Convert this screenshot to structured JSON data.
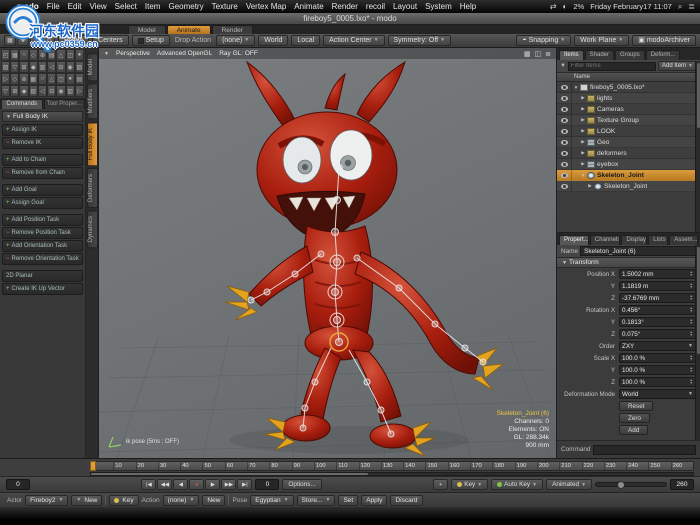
{
  "watermark": {
    "title": "河东软件园",
    "url": "www.pc0359.cn"
  },
  "menubar": {
    "apple": "",
    "items": [
      "modo",
      "File",
      "Edit",
      "View",
      "Select",
      "Item",
      "Geometry",
      "Texture",
      "Vertex Map",
      "Animate",
      "Render",
      "recoil",
      "Layout",
      "System",
      "Help"
    ],
    "status_icons": [
      "⇄",
      "◐"
    ],
    "battery": "2%",
    "clock": "Friday February17 11:07",
    "search_icon": "⌕",
    "list_icon": "≣"
  },
  "titlebar": {
    "title": "fireboy5_0005.lxo* - modo"
  },
  "layout_tabs": {
    "tabs": [
      {
        "label": "Model"
      },
      {
        "label": "Animate",
        "active": true
      },
      {
        "label": "Render"
      }
    ]
  },
  "toolbar": {
    "left_icons": [
      "▦",
      "✚",
      "○",
      "◇"
    ],
    "pivots": "Pivots",
    "centers": "Centers",
    "setup": "Setup",
    "drop_action_label": "Drop Action",
    "drop_action_value": "(none)",
    "world": "World",
    "local": "Local",
    "action_center": "Action Center",
    "symmetry": "Symmetry: Off",
    "snapping": "Snapping",
    "snapping_icon": "◓",
    "work_plane": "Work Plane",
    "archiver": "modoArchiver",
    "archiver_icon": "▣"
  },
  "palette": {
    "glyphs": [
      "◰",
      "▦",
      "○",
      "◇",
      "⊕",
      "▤",
      "△",
      "◫",
      "●",
      "▧",
      "▽",
      "⊞",
      "◆",
      "▥",
      "◁",
      "⊟",
      "◉",
      "▨",
      "▷",
      "◇",
      "⊕",
      "▦",
      "○",
      "△",
      "◫",
      "●",
      "▤",
      "▽",
      "⊞",
      "◆",
      "▧",
      "◁",
      "⊟",
      "◉",
      "▥",
      "▷"
    ]
  },
  "left_panel": {
    "tabs": [
      {
        "label": "Commands",
        "active": true
      },
      {
        "label": "Tool Proper..."
      }
    ],
    "section": "Full Body IK",
    "buttons": [
      {
        "label": "Assign IK",
        "icon": "+"
      },
      {
        "label": "Remove IK",
        "icon": "−",
        "gap": true
      },
      {
        "label": "Add to Chain",
        "icon": "+"
      },
      {
        "label": "Remove from Chain",
        "icon": "−",
        "gap": true
      },
      {
        "label": "Add Goal",
        "icon": "+"
      },
      {
        "label": "Assign Goal",
        "icon": "+",
        "gap": true
      },
      {
        "label": "Add Position Task",
        "icon": "+"
      },
      {
        "label": "Remove Position Task",
        "icon": "−"
      },
      {
        "label": "Add Orientation Task",
        "icon": "+"
      },
      {
        "label": "Remove Orientation Task",
        "icon": "−",
        "gap": true
      },
      {
        "label": "2D Planar",
        "icon": ""
      },
      {
        "label": "Create IK Up Vector",
        "icon": "+"
      }
    ],
    "vertical_tabs": [
      {
        "label": "Model"
      },
      {
        "label": "Modifiers"
      },
      {
        "label": "Full Body IK",
        "active": true
      },
      {
        "label": "Deformers"
      },
      {
        "label": "Dynamics"
      }
    ]
  },
  "viewport": {
    "view_mode": "Perspective",
    "shading": "Advanced OpenGL",
    "raygl": "Ray GL: OFF",
    "header_icons": [
      "▦",
      "◫",
      "≣"
    ],
    "axis_label": "ik pose (5ms : OFF)",
    "info_title": "Skeleton_Joint (6)",
    "info_lines": [
      "Channels: 0",
      "Elements: ON",
      "GL: 288.34k",
      "900 mm"
    ]
  },
  "items_panel": {
    "tabs": [
      {
        "label": "Items",
        "active": true
      },
      {
        "label": "Shader"
      },
      {
        "label": "Groups"
      },
      {
        "label": "Deform..."
      }
    ],
    "filter_placeholder": "Filter Items",
    "add_item": "Add Item",
    "name_header": "Name",
    "rows": [
      {
        "label": "fireboy5_0005.lxo*",
        "indent": 0,
        "type": "scene",
        "twisty": "▼"
      },
      {
        "label": "lights",
        "indent": 1,
        "type": "folder",
        "twisty": "▶"
      },
      {
        "label": "Cameras",
        "indent": 1,
        "type": "folder",
        "twisty": "▶"
      },
      {
        "label": "Texture Group",
        "indent": 1,
        "type": "folder",
        "twisty": "▶"
      },
      {
        "label": "LOOK",
        "indent": 1,
        "type": "folder",
        "twisty": "▶"
      },
      {
        "label": "Geo",
        "indent": 1,
        "type": "mesh",
        "twisty": "▶"
      },
      {
        "label": "deformers",
        "indent": 1,
        "type": "folder",
        "twisty": "▶"
      },
      {
        "label": "eyebox",
        "indent": 1,
        "type": "mesh",
        "twisty": "▶"
      },
      {
        "label": "Skeleton_Joint",
        "indent": 1,
        "type": "locator",
        "twisty": "▼",
        "selected": true
      },
      {
        "label": "Skeleton_Joint",
        "indent": 2,
        "type": "locator",
        "twisty": "▶"
      }
    ]
  },
  "properties": {
    "tabs": [
      {
        "label": "Propert...",
        "active": true
      },
      {
        "label": "Channels"
      },
      {
        "label": "Display"
      },
      {
        "label": "Lists"
      },
      {
        "label": "Assem..."
      }
    ],
    "name_label": "Name",
    "name_value": "Skeleton_Joint (6)",
    "section": "Transform",
    "rows": [
      {
        "label": "Position X",
        "value": "1.5002 mm",
        "control": "stepper"
      },
      {
        "label": "Y",
        "value": "1.1819 m",
        "control": "stepper"
      },
      {
        "label": "Z",
        "value": "-37.6769 mm",
        "control": "stepper"
      },
      {
        "label": "Rotation X",
        "value": "0.456°",
        "control": "stepper"
      },
      {
        "label": "Y",
        "value": "0.1813°",
        "control": "stepper"
      },
      {
        "label": "Z",
        "value": "0.075°",
        "control": "stepper"
      },
      {
        "label": "Order",
        "value": "ZXY",
        "control": "dropdown"
      },
      {
        "label": "Scale X",
        "value": "100.0 %",
        "control": "stepper"
      },
      {
        "label": "Y",
        "value": "100.0 %",
        "control": "stepper"
      },
      {
        "label": "Z",
        "value": "100.0 %",
        "control": "stepper"
      },
      {
        "label": "Deformation Mode",
        "value": "World",
        "control": "dropdown"
      }
    ],
    "buttons": [
      "Reset",
      "Zero",
      "Add"
    ],
    "command_label": "Command"
  },
  "timeline": {
    "ticks": [
      "0",
      "10",
      "20",
      "30",
      "40",
      "50",
      "60",
      "70",
      "80",
      "90",
      "100",
      "110",
      "120",
      "130",
      "140",
      "150",
      "160",
      "170",
      "180",
      "190",
      "200",
      "210",
      "220",
      "230",
      "240",
      "250",
      "260"
    ]
  },
  "transport": {
    "range_start": "0",
    "buttons": [
      "|◀",
      "◀◀",
      "◀",
      "●",
      "▶",
      "▶▶",
      "▶|"
    ],
    "current_frame": "0",
    "options": "Options...",
    "add_key": "+",
    "key": "Key",
    "auto_key": "Auto Key",
    "animated": "Animated",
    "range_end": "260"
  },
  "actor_row": {
    "actor_label": "Actor",
    "actor_value": "Fireboy2",
    "new1": "New",
    "key": "Key",
    "action_label": "Action",
    "action_value": "(none)",
    "new2": "New",
    "pose_label": "Pose",
    "pose_value": "Egyptian",
    "store": "Store...",
    "set": "Set",
    "apply": "Apply",
    "discard": "Discard"
  }
}
